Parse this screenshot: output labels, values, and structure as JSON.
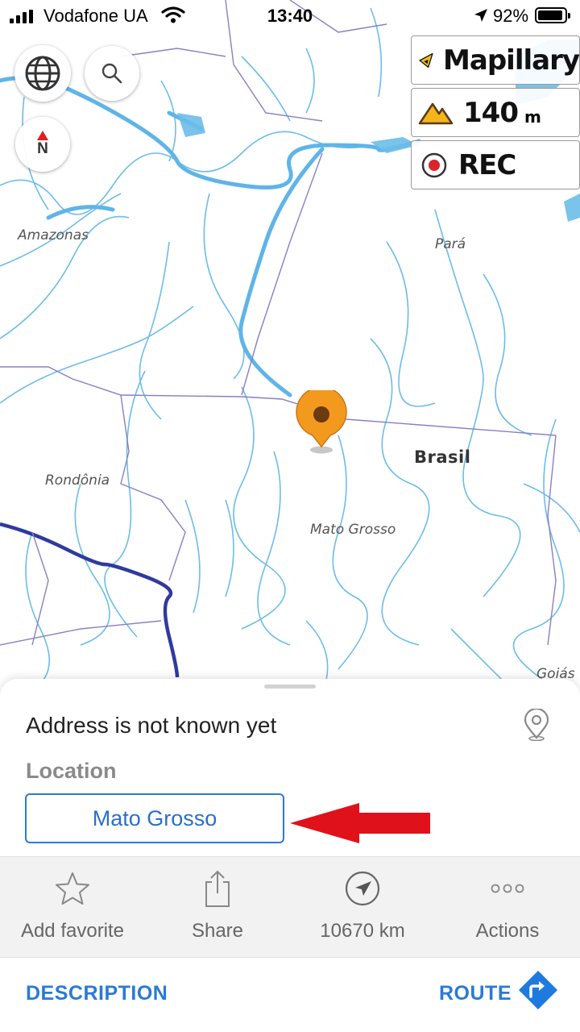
{
  "status_bar": {
    "carrier": "Vodafone UA",
    "time": "13:40",
    "battery": "92%",
    "icons": [
      "signal-icon",
      "wifi-icon",
      "location-arrow-icon",
      "battery-icon"
    ]
  },
  "map": {
    "region_labels": [
      "Amazonas",
      "Pará",
      "Rondônia",
      "Mato Grosso",
      "Goiás"
    ],
    "country_label": "Brasil",
    "colors": {
      "river": "#5fb4e8",
      "major_river": "#3a3aa0",
      "border": "#8a7fc4"
    }
  },
  "map_controls": {
    "globe_icon": "globe-icon",
    "search_icon": "search-icon",
    "compass_label": "N"
  },
  "panels": {
    "mapillary": "Mapillary",
    "altitude_value": "140",
    "altitude_unit": "m",
    "rec": "REC"
  },
  "sheet": {
    "address": "Address is not known yet",
    "location_label": "Location",
    "location_value": "Mato Grosso",
    "actions": [
      {
        "label": "Add favorite",
        "icon": "star-icon"
      },
      {
        "label": "Share",
        "icon": "share-icon"
      },
      {
        "label": "10670 km",
        "icon": "direction-icon"
      },
      {
        "label": "Actions",
        "icon": "more-icon"
      }
    ],
    "description": "DESCRIPTION",
    "route": "ROUTE"
  },
  "accent": "#2a7ad6",
  "pin_color": "#f39a1e",
  "annotation_arrow_color": "#e0111b"
}
